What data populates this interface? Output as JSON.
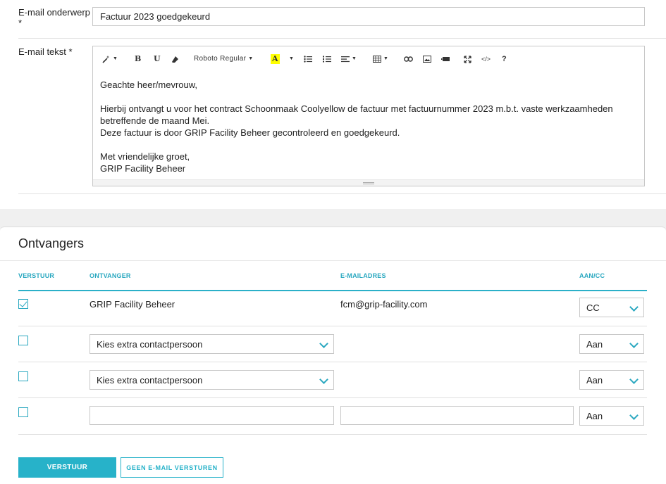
{
  "email_form": {
    "subject_label": "E-mail onderwerp",
    "subject_required": "*",
    "subject_value": "Factuur 2023 goedgekeurd",
    "body_label": "E-mail tekst *",
    "toolbar": {
      "font_name": "Roboto Regular",
      "highlight_letter": "A",
      "bold": "B",
      "underline": "U",
      "help": "?",
      "code": "</>"
    },
    "body_lines": [
      "Geachte heer/mevrouw,",
      "",
      "Hierbij ontvangt u voor het contract Schoonmaak Coolyellow de factuur met factuurnummer 2023 m.b.t. vaste werkzaamheden betreffende de maand Mei.",
      "Deze factuur is door GRIP Facility Beheer gecontroleerd en goedgekeurd.",
      "",
      "Met vriendelijke groet,",
      "GRIP Facility Beheer"
    ]
  },
  "recipients": {
    "title": "Ontvangers",
    "columns": {
      "send": "VERSTUUR",
      "recipient": "ONTVANGER",
      "email": "E-MAILADRES",
      "to_cc": "AAN/CC"
    },
    "rows": [
      {
        "checked": true,
        "recipient": "GRIP Facility Beheer",
        "email": "fcm@grip-facility.com",
        "to_cc": "CC"
      },
      {
        "checked": false,
        "recipient_select": "Kies extra contactpersoon",
        "to_cc": "Aan"
      },
      {
        "checked": false,
        "recipient_select": "Kies extra contactpersoon",
        "to_cc": "Aan"
      },
      {
        "checked": false,
        "recipient_input": "",
        "email_input": "",
        "to_cc": "Aan"
      }
    ]
  },
  "actions": {
    "send_label": "VERSTUUR",
    "no_email_label": "GEEN E-MAIL VERSTUREN"
  },
  "colors": {
    "accent": "#27b2c9",
    "highlight": "#ffff00",
    "background": "#f0f0f0"
  }
}
